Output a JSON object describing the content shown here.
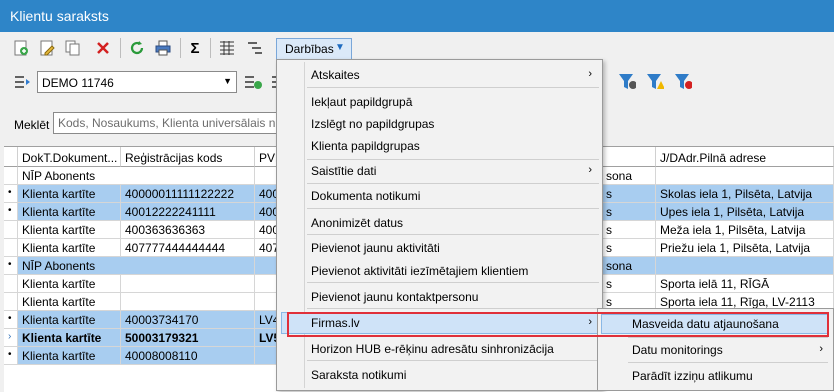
{
  "window": {
    "title": "Klientu saraksts"
  },
  "toolbar": {
    "actions_label": "Darbības",
    "colors": {
      "titlebar": "#2e85c8",
      "selection": "#a8cdf0",
      "highlight": "#cfe3f8",
      "outline": "#e0303a"
    }
  },
  "filter": {
    "selected": "DEMO 11746"
  },
  "search": {
    "label": "Meklēt",
    "placeholder": "Kods, Nosaukums, Klienta universālais numurs"
  },
  "columns": [
    "DokT.Dokument...",
    "Reģistrācijas kods",
    "PVN",
    "J/DAdr.Pilnā adrese"
  ],
  "rows": [
    {
      "doc": "NĪP Abonents",
      "code": "",
      "pvn": "",
      "extra": "sona",
      "addr": ""
    },
    {
      "doc": "Klienta kartīte",
      "code": "40000011111122222",
      "pvn": "400",
      "extra": "s",
      "addr": "Skolas iela 1, Pilsēta, Latvija"
    },
    {
      "doc": "Klienta kartīte",
      "code": "40012222241111",
      "pvn": "400",
      "extra": "s",
      "addr": "Upes iela 1, Pilsēta, Latvija"
    },
    {
      "doc": "Klienta kartīte",
      "code": "400363636363",
      "pvn": "400",
      "extra": "s",
      "addr": "Meža iela 1, Pilsēta, Latvija"
    },
    {
      "doc": "Klienta kartīte",
      "code": "407777444444444",
      "pvn": "407",
      "extra": "s",
      "addr": "Priežu iela 1, Pilsēta, Latvija"
    },
    {
      "doc": "NĪP Abonents",
      "code": "",
      "pvn": "",
      "extra": "sona",
      "addr": ""
    },
    {
      "doc": "Klienta kartīte",
      "code": "",
      "pvn": "",
      "extra": "s",
      "addr": "Sporta ielā 11, RĪGĀ"
    },
    {
      "doc": "Klienta kartīte",
      "code": "",
      "pvn": "",
      "extra": "s",
      "addr": "Sporta iela 11, Rīga, LV-2113"
    },
    {
      "doc": "Klienta kartīte",
      "code": "40003734170",
      "pvn": "LV4",
      "extra": "",
      "addr": ""
    },
    {
      "doc": "Klienta kartīte",
      "code": "50003179321",
      "pvn": "LV5",
      "extra": "",
      "addr": ""
    },
    {
      "doc": "Klienta kartīte",
      "code": "40008008110",
      "pvn": "",
      "extra": "",
      "addr": ""
    }
  ],
  "menu": {
    "items": [
      "Atskaites",
      "Iekļaut papildgrupā",
      "Izslēgt no papildgrupas",
      "Klienta papildgrupas",
      "Saistītie dati",
      "Dokumenta notikumi",
      "Anonimizēt datus",
      "Pievienot jaunu aktivitāti",
      "Pievienot aktivitāti iezīmētajiem klientiem",
      "Pievienot jaunu kontaktpersonu",
      "Firmas.lv",
      "Horizon HUB e-rēķinu adresātu sinhronizācija",
      "Saraksta notikumi"
    ]
  },
  "submenu": {
    "items": [
      "Masveida datu atjaunošana",
      "Datu monitorings",
      "Parādīt izziņu atlikumu"
    ]
  }
}
